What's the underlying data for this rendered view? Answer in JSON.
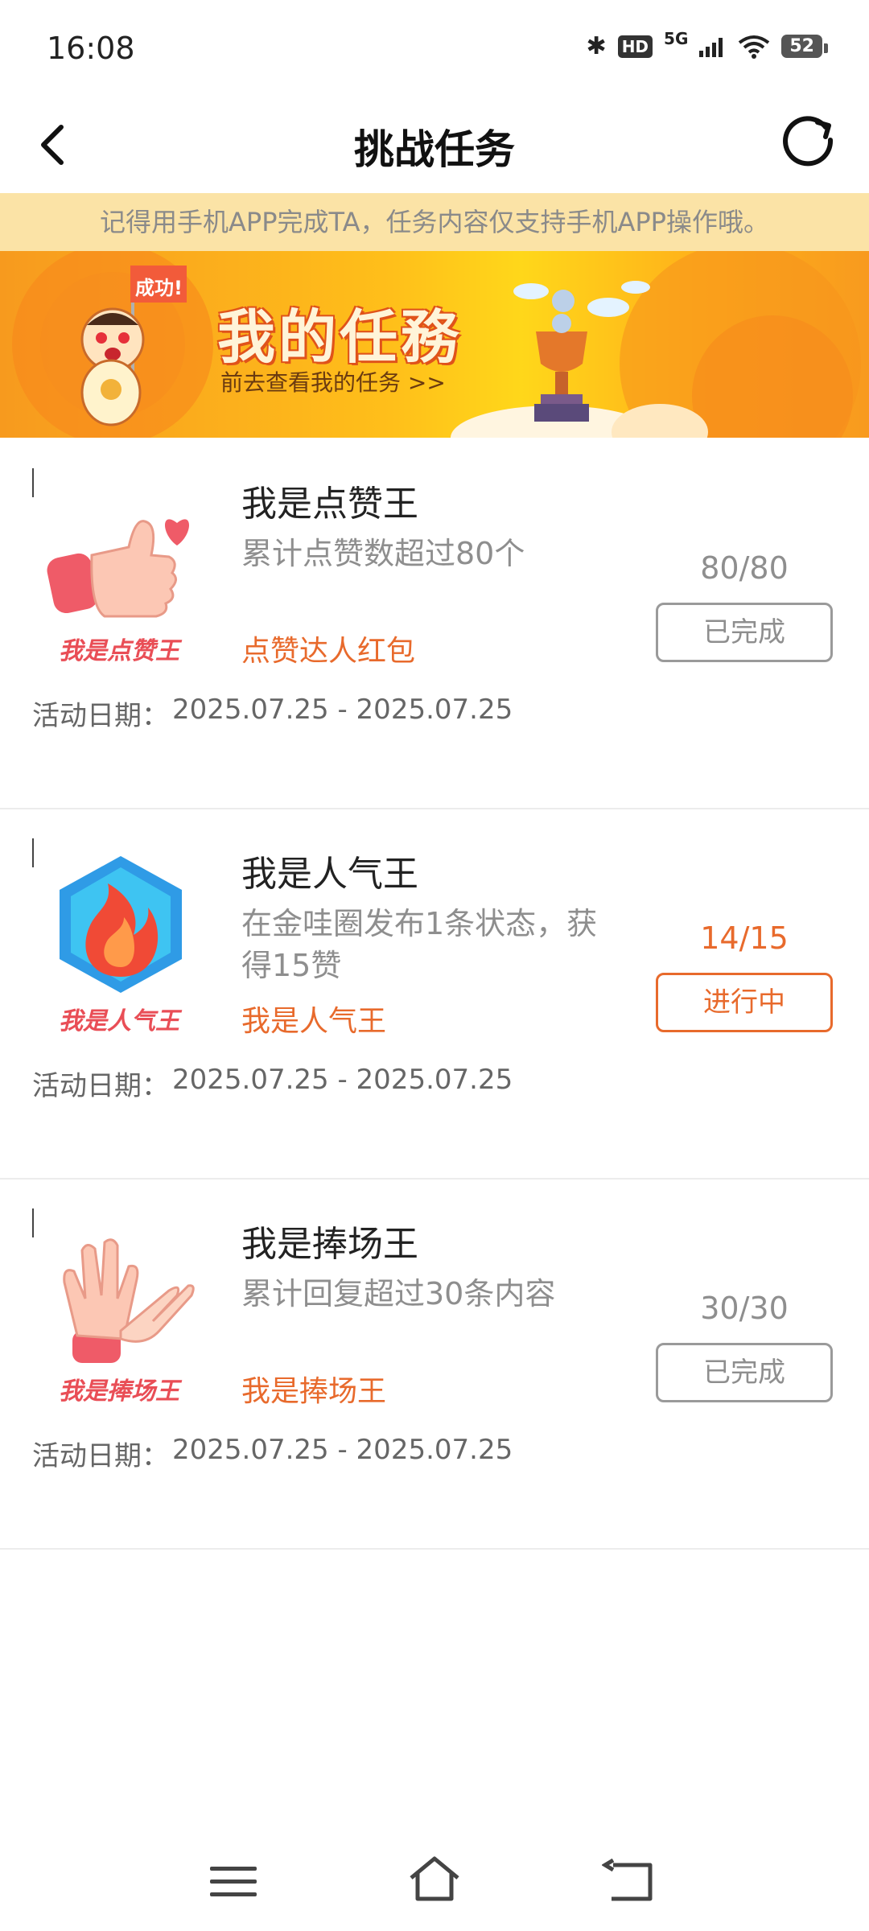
{
  "status_bar": {
    "time": "16:08",
    "hd": "HD",
    "network": "5G",
    "battery": "52"
  },
  "header": {
    "title": "挑战任务",
    "back_icon": "chevron-left-icon",
    "refresh_icon": "refresh-icon"
  },
  "notice": "记得用手机APP完成TA，任务内容仅支持手机APP操作哦。",
  "banner": {
    "title": "我的任務",
    "subtitle": "前去查看我的任务 >>",
    "flag_text": "成功!"
  },
  "date_label": "活动日期：",
  "tasks": [
    {
      "image_label": "我是点赞王",
      "name": "我是点赞王",
      "desc": "累计点赞数超过80个",
      "reward": "点赞达人红包",
      "progress": "80/80",
      "status": "已完成",
      "date": "2025.07.25 - 2025.07.25",
      "icon": "thumbs-up-icon"
    },
    {
      "image_label": "我是人气王",
      "name": "我是人气王",
      "desc": "在金哇圈发布1条状态，获得15赞",
      "reward": "我是人气王",
      "progress": "14/15",
      "status": "进行中",
      "date": "2025.07.25 - 2025.07.25",
      "icon": "flame-icon"
    },
    {
      "image_label": "我是捧场王",
      "name": "我是捧场王",
      "desc": "累计回复超过30条内容",
      "reward": "我是捧场王",
      "progress": "30/30",
      "status": "已完成",
      "date": "2025.07.25 - 2025.07.25",
      "icon": "clapping-hands-icon"
    }
  ],
  "colors": {
    "accent": "#e86a2c",
    "notice_bg": "#fbe3a6",
    "muted": "#8e8e8e"
  }
}
